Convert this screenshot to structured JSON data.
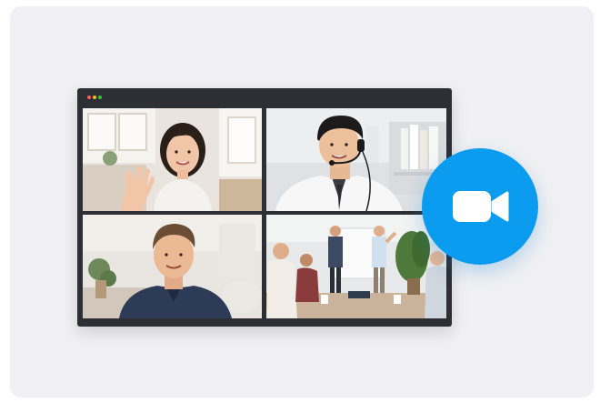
{
  "window": {
    "traffic_lights": [
      "#ff5f57",
      "#febc2e",
      "#28c840"
    ]
  },
  "participants": [
    {
      "icon": "participant-woman-waving"
    },
    {
      "icon": "participant-man-headset"
    },
    {
      "icon": "participant-man-smiling"
    },
    {
      "icon": "participant-office-meeting"
    }
  ],
  "colors": {
    "card_background": "#f1f1f3",
    "window_frame": "#2d2f34",
    "badge_blue": "#0b9cf0",
    "camera_icon": "#ffffff"
  },
  "badge": {
    "icon": "video-camera-icon"
  }
}
